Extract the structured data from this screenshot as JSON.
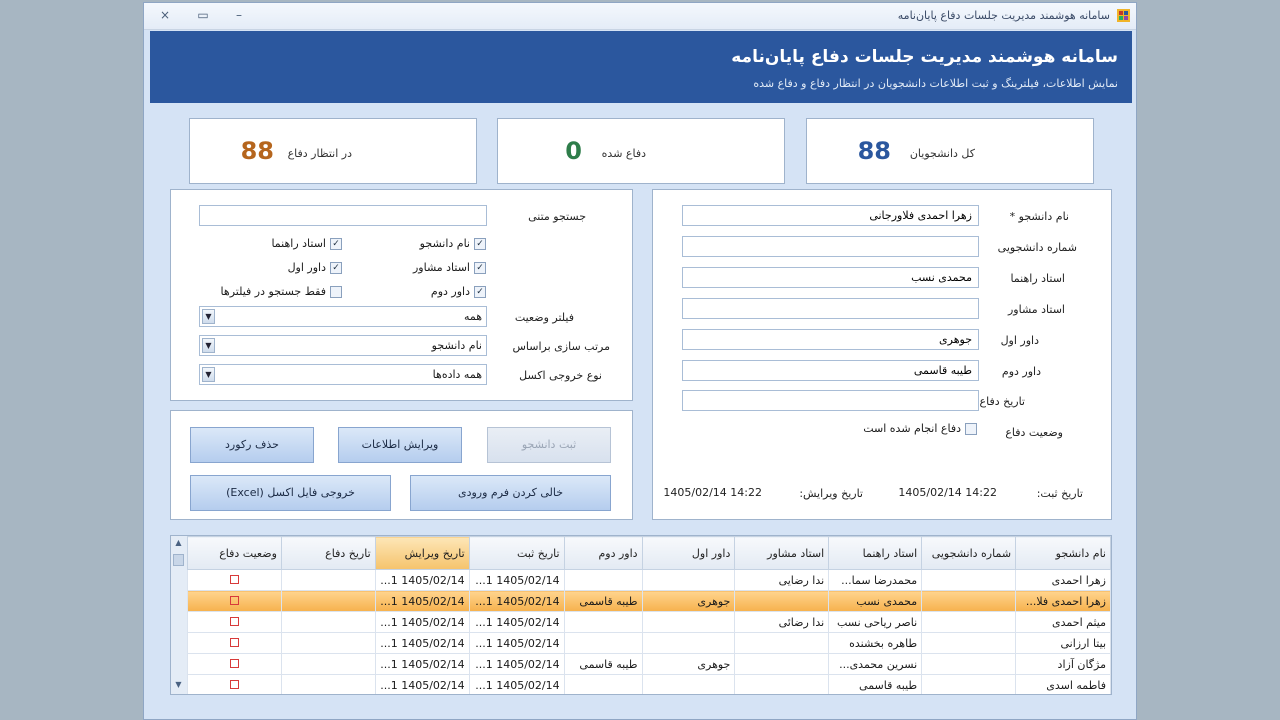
{
  "window": {
    "title": "سامانه هوشمند مدیریت جلسات دفاع پایان‌نامه",
    "close_glyph": "×",
    "maximize_glyph": "▭",
    "minimize_glyph": "–"
  },
  "header": {
    "title": "سامانه هوشمند مدیریت جلسات دفاع پایان‌نامه",
    "subtitle": "نمایش اطلاعات، فیلترینگ و ثبت اطلاعات دانشجویان در انتظار دفاع و دفاع شده"
  },
  "stats": {
    "total": {
      "label": "کل دانشجویان",
      "value": "88",
      "color": "#2b579e"
    },
    "defended": {
      "label": "دفاع شده",
      "value": "0",
      "color": "#2e7d4a"
    },
    "pending": {
      "label": "در انتظار دفاع",
      "value": "88",
      "color": "#b5651d"
    }
  },
  "filter": {
    "search_label": "جستجو متنی",
    "search_value": "",
    "checks": {
      "student_name": {
        "label": "نام دانشجو",
        "checked": true
      },
      "supervisor": {
        "label": "استاد راهنما",
        "checked": true
      },
      "advisor": {
        "label": "استاد مشاور",
        "checked": true
      },
      "referee1": {
        "label": "داور اول",
        "checked": true
      },
      "referee2": {
        "label": "داور دوم",
        "checked": true
      },
      "filtered_only": {
        "label": "فقط جستجو در فیلترها",
        "checked": false
      }
    },
    "status_label": "فیلتر وضعیت",
    "status_value": "همه",
    "sort_label": "مرتب سازی براساس",
    "sort_value": "نام دانشجو",
    "export_label": "نوع خروجی اکسل",
    "export_value": "همه داده‌ها",
    "combo_arrow": "▼",
    "check_glyph": "✓"
  },
  "actions": {
    "register": "ثبت دانشجو",
    "edit": "ویرایش اطلاعات",
    "delete": "حذف رکورد",
    "clear": "خالی کردن فرم ورودی",
    "excel": "خروجی فایل اکسل (Excel)"
  },
  "form": {
    "name_label": "نام دانشجو *",
    "name_value": "زهرا احمدی فلاورجانی",
    "id_label": "شماره دانشجویی",
    "id_value": "",
    "supervisor_label": "استاد راهنما",
    "supervisor_value": "محمدی نسب",
    "advisor_label": "استاد مشاور",
    "advisor_value": "",
    "referee1_label": "داور اول",
    "referee1_value": "جوهری",
    "referee2_label": "داور دوم",
    "referee2_value": "طیبه قاسمی",
    "date_label": "تاریخ دفاع",
    "date_value": "",
    "status_label": "وضعیت دفاع",
    "status_check_label": "دفاع انجام شده است",
    "status_checked": false,
    "created_label": "تاریخ ثبت:",
    "created_value": "1405/02/14  14:22",
    "edited_label": "تاریخ ویرایش:",
    "edited_value": "1405/02/14  14:22"
  },
  "grid": {
    "columns": [
      "نام دانشجو",
      "شماره دانشجویی",
      "استاد راهنما",
      "استاد مشاور",
      "داور اول",
      "داور دوم",
      "تاریخ ثبت",
      "تاریخ ویرایش",
      "تاریخ دفاع",
      "وضعیت دفاع"
    ],
    "scroll_up": "▲",
    "scroll_down": "▼",
    "rows": [
      [
        "زهرا احمدی",
        "",
        "محمدرضا سما...",
        "ندا رضایی",
        "",
        "",
        "1405/02/14  1...",
        "1405/02/14  1...",
        "",
        ""
      ],
      [
        "زهرا احمدی فلا...",
        "",
        "محمدی نسب",
        "",
        "جوهری",
        "طیبه قاسمی",
        "1405/02/14  1...",
        "1405/02/14  1...",
        "",
        ""
      ],
      [
        "میثم احمدی",
        "",
        "ناصر ریاحی نسب",
        "ندا رضائی",
        "",
        "",
        "1405/02/14  1...",
        "1405/02/14  1...",
        "",
        ""
      ],
      [
        "بیتا ارزانی",
        "",
        "طاهره بخشنده",
        "",
        "",
        "",
        "1405/02/14  1...",
        "1405/02/14  1...",
        "",
        ""
      ],
      [
        "مژگان آزاد",
        "",
        "نسرین محمدی...",
        "",
        "جوهری",
        "طیبه قاسمی",
        "1405/02/14  1...",
        "1405/02/14  1...",
        "",
        ""
      ],
      [
        "فاطمه اسدی",
        "",
        "طیبه قاسمی",
        "",
        "",
        "",
        "1405/02/14  1...",
        "1405/02/14  1...",
        "",
        ""
      ]
    ],
    "selected_row": 1
  }
}
